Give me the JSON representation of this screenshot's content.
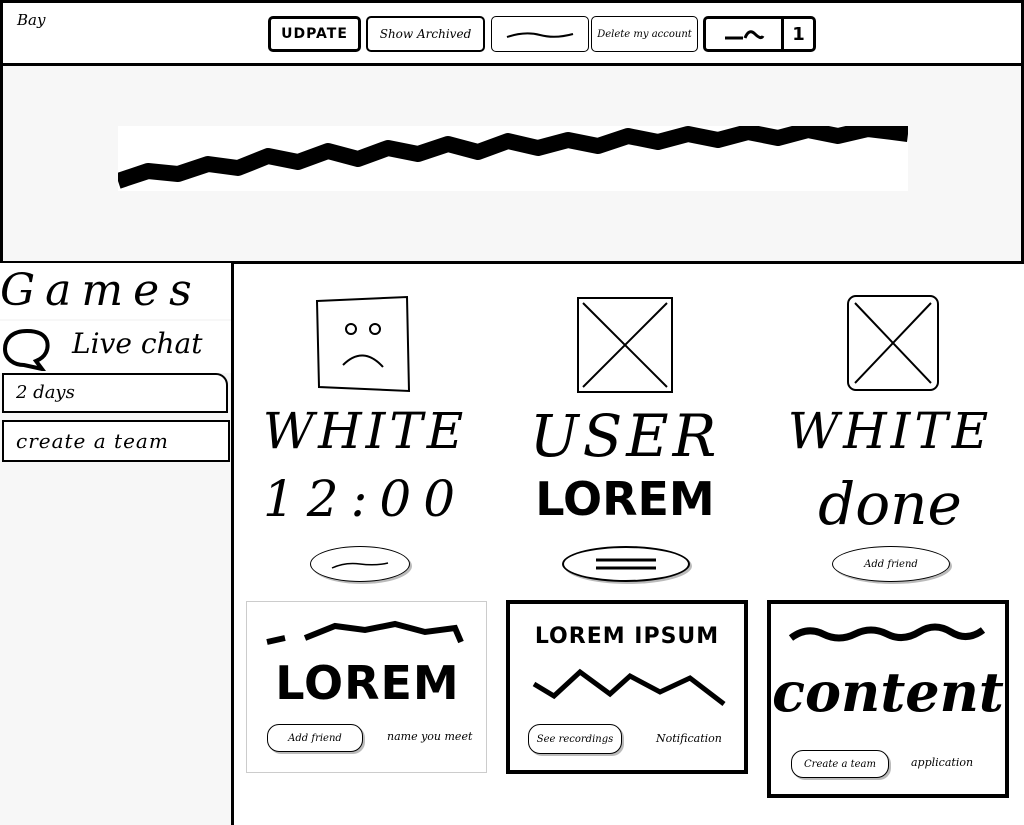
{
  "header": {
    "logo": "Bay",
    "update_label": "UDPATE",
    "archived_label": "Show Archived",
    "delete_label": "Delete my account",
    "badge_count": "1"
  },
  "sidebar": {
    "title": "Games",
    "live_chat": "Live chat",
    "days": "2 days",
    "create_team": "create a team"
  },
  "profiles": [
    {
      "name": "WHITE",
      "subtitle": "12:00",
      "button": ""
    },
    {
      "name": "USER",
      "subtitle": "LOREM",
      "button": ""
    },
    {
      "name": "WHITE",
      "subtitle": "done",
      "button": "Add friend"
    }
  ],
  "cards": [
    {
      "title": "LOREM",
      "button": "Add friend",
      "link": "name you meet"
    },
    {
      "title": "LOREM IPSUM",
      "button": "See recordings",
      "link": "Notification"
    },
    {
      "title": "content",
      "button": "Create a team",
      "link": "application"
    }
  ]
}
